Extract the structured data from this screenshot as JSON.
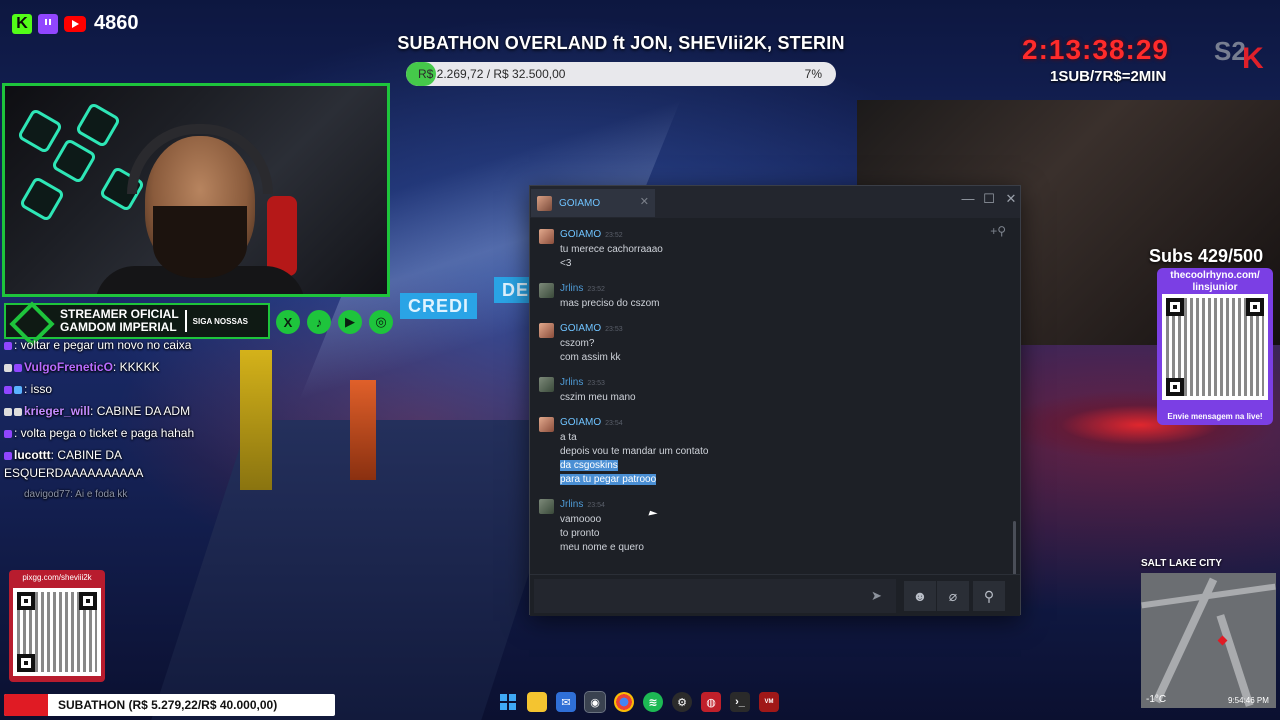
{
  "stream_header": {
    "viewers": "4860",
    "subathon_title": "SUBATHON OVERLAND ft JON, SHEVIii2K, STERIN",
    "goal_text": "R$ 2.269,72 / R$ 32.500,00",
    "goal_percent_label": "7%",
    "goal_progress": 0.07,
    "timer": "2:13:38:29",
    "timer_rule": "1SUB/7R$=2MIN",
    "brand_logo_text": "S2K"
  },
  "background_signs": [
    "CREDI",
    "DE"
  ],
  "banner": {
    "line1": "STREAMER OFICIAL",
    "line2": "GAMDOM IMPERIAL",
    "follow_label": "SIGA NOSSAS",
    "socials": [
      "x-icon",
      "tiktok-icon",
      "youtube-icon",
      "instagram-icon"
    ]
  },
  "chat": [
    {
      "user": "",
      "text": ": voltar e pegar um novo no caixa",
      "user_color": "#7a7aff"
    },
    {
      "user": "VulgoFreneticO",
      "text": ": KKKKK",
      "user_color": "#b86bff"
    },
    {
      "user": "",
      "text": ": isso",
      "user_color": "#6b6bff"
    },
    {
      "user": "krieger_will",
      "text": ": CABINE DA ADM",
      "user_color": "#c48bff"
    },
    {
      "user": "",
      "text": ": volta pega o ticket e paga hahah",
      "user_color": "#4a6bff"
    },
    {
      "user": "lucottt",
      "text": ": CABINE DA ESQUERDAAAAAAAAAA",
      "user_color": "#ffffff"
    },
    {
      "user": "davigod77",
      "text": ": Ai e foda kk",
      "user_color": "#8c93a8"
    }
  ],
  "pix": {
    "url": "pixgg.com/sheviii2k"
  },
  "subathon_bottom": "SUBATHON (R$ 5.279,22/R$ 40.000,00)",
  "subs": {
    "label": "Subs 429/500"
  },
  "qr_card": {
    "url_line1": "thecoolrhyno.com/",
    "url_line2": "linsjunior",
    "message": "Envie mensagem na live!"
  },
  "minimap": {
    "city": "SALT LAKE CITY",
    "temp": "-1°C",
    "time": "9:54:46 PM"
  },
  "taskbar": [
    "windows-icon",
    "folder-icon",
    "app-icon",
    "steam-icon",
    "chrome-icon",
    "spotify-icon",
    "settings-icon",
    "obs-icon",
    "terminal-icon",
    "voicemeeter-icon"
  ],
  "steam_chat": {
    "tab_title": "GOIAMO",
    "messages": [
      {
        "name": "GOIAMO",
        "time": "23:52",
        "lines": [
          "tu merece cachorraaao",
          "<3"
        ]
      },
      {
        "name": "Jrlins",
        "time": "23:52",
        "lines": [
          "mas preciso do cszom"
        ]
      },
      {
        "name": "GOIAMO",
        "time": "23:53",
        "lines": [
          "cszom?",
          "com assim kk"
        ]
      },
      {
        "name": "Jrlins",
        "time": "23:53",
        "lines": [
          "cszim meu mano"
        ]
      },
      {
        "name": "GOIAMO",
        "time": "23:54",
        "lines": [
          "a ta",
          "depois vou te mandar um contato",
          "da csgoskins",
          "para tu pegar patrooo"
        ]
      },
      {
        "name": "Jrlins",
        "time": "23:54",
        "lines": [
          "vamoooo",
          "to pronto",
          "meu nome e quero"
        ]
      }
    ]
  }
}
